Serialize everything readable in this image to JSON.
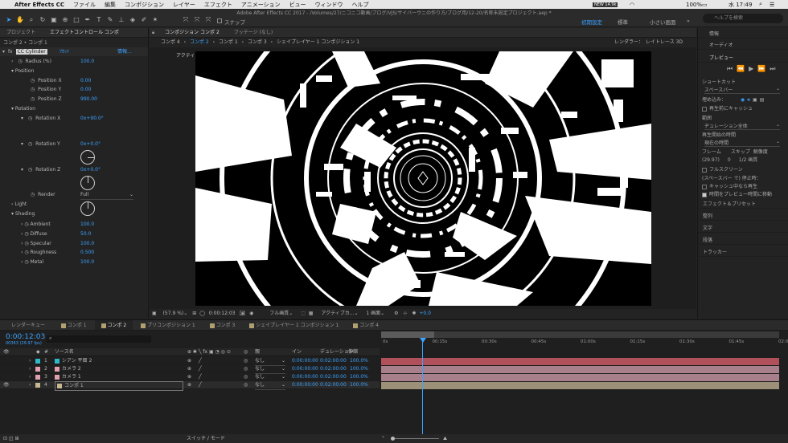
{
  "menubar": {
    "app_name": "After Effects CC",
    "items": [
      "ファイル",
      "編集",
      "コンポジション",
      "レイヤー",
      "エフェクト",
      "アニメーション",
      "ビュー",
      "ウィンドウ",
      "ヘルプ"
    ],
    "battery": "100%",
    "clock": "水 17:49",
    "net_label": "NEW 14.9k"
  },
  "toolbar": {
    "title": "Adobe After Effects CC 2017 - /Volumes/27/ニコニコ動画/ブログ/VJS/サイバーウニの作り方/ブログ用/12-20/名称未設定プロジェクト.aep *",
    "snap_label": "スナップ",
    "workspaces": [
      "初期設定",
      "標準",
      "小さい画面"
    ],
    "active_workspace": "初期設定",
    "help_placeholder": "ヘルプを検索"
  },
  "left_panel": {
    "tabs": [
      "プロジェクト",
      "エフェクトコントロール コンポ"
    ],
    "active_tab": "エフェクトコントロール コンポ",
    "header": "コンポ 2 • コンポ 1",
    "effect_name": "CC Cylinder",
    "reset_label": "ﾘｾｯﾄ",
    "info_label": "情報...",
    "radius": {
      "label": "Radius (%)",
      "value": "100.0"
    },
    "position_group": "Position",
    "position_x": {
      "label": "Position X",
      "value": "0.00"
    },
    "position_y": {
      "label": "Position Y",
      "value": "0.00"
    },
    "position_z": {
      "label": "Position Z",
      "value": "990.00"
    },
    "rotation_group": "Rotation",
    "rotation_x": {
      "label": "Rotation X",
      "value": "0x+90.0°"
    },
    "rotation_y": {
      "label": "Rotation Y",
      "value": "0x+0.0°"
    },
    "rotation_z": {
      "label": "Rotation Z",
      "value": "0x+0.0°"
    },
    "render": {
      "label": "Render",
      "value": "Full"
    },
    "light_group": "Light",
    "shading_group": "Shading",
    "ambient": {
      "label": "Ambient",
      "value": "100.0"
    },
    "diffuse": {
      "label": "Diffuse",
      "value": "50.0"
    },
    "specular": {
      "label": "Specular",
      "value": "100.0"
    },
    "roughness": {
      "label": "Roughness",
      "value": "0.500"
    },
    "metal": {
      "label": "Metal",
      "value": "100.0"
    }
  },
  "comp_panel": {
    "tabs": [
      "コンポジション コンポ 2",
      "フッテージ (なし)"
    ],
    "active_tab": "コンポジション コンポ 2",
    "breadcrumb": [
      "コンポ 4",
      "コンポ 2",
      "コンポ 1",
      "コンポ 3",
      "シェイプレイヤー 1 コンポジション 1"
    ],
    "active_crumb": "コンポ 2",
    "renderer_label": "レンダラー：",
    "renderer_value": "レイトレース 3D",
    "camera_label": "アクティブカメラ",
    "zoom": "(57.9 %)",
    "timecode": "0:00:12:03",
    "resolution": "フル画質",
    "view_camera": "アクティブカ...",
    "views": "1 画面",
    "exposure": "+0.0"
  },
  "right_panel": {
    "info": "情報",
    "audio": "オーディオ",
    "preview": "プレビュー",
    "shortcut_label": "ショートカット",
    "shortcut_value": "スペースバー",
    "embed_label": "埋め込み：",
    "cache_before": "再生前にキャッシュ",
    "range_label": "範囲",
    "range_value": "ヂュレーション全体",
    "play_from_label": "再生開始の時間",
    "play_from_value": "現在の時間",
    "frame_rate_label": "フレーム",
    "skip_label": "スキップ",
    "resolution_label": "解像度",
    "frame_rate_value": "(29.97)",
    "skip_value": "0",
    "resolution_value": "1/2 画質",
    "fullscreen": "フルスクリーン",
    "stop_label": "(スペースバー で) 停止時：",
    "stop_opt1": "キャッシュ中なら再生",
    "stop_opt2": "時間をプレビュー時間に移動",
    "sections": [
      "エフェクト＆プリセット",
      "整列",
      "文字",
      "段落",
      "トラッカー"
    ]
  },
  "timeline": {
    "tabs": [
      "レンダーキュー",
      "コンポ 1",
      "コンポ 2",
      "プリコンポジション 1",
      "コンポ 3",
      "シェイプレイヤー 1 コンポジション 1",
      "コンポ 4"
    ],
    "tab_colors": [
      "#aaaaaa",
      "#b0a070",
      "#b0a070",
      "#b0a070",
      "#b0a070",
      "#b0a070",
      "#b0a070"
    ],
    "active_tab": "コンポ 2",
    "current_time": "0:00:12:03",
    "frame_info": "00363 (29.97 fps)",
    "columns": {
      "num": "#",
      "source": "ソース名",
      "parent": "親",
      "in": "イン",
      "duration": "デュレーション",
      "stretch": "伸縮"
    },
    "ruler": [
      "0s",
      "00:15s",
      "00:30s",
      "00:45s",
      "01:00s",
      "01:15s",
      "01:30s",
      "01:45s",
      "02:0"
    ],
    "layers": [
      {
        "num": "1",
        "name": "シアン 平面 2",
        "color": "#2fb8c8",
        "parent": "なし",
        "in": "0:00:00:00",
        "duration": "0:02:00:00",
        "stretch": "100.0%",
        "bar_color": "#b0505a"
      },
      {
        "num": "2",
        "name": "カメラ 2",
        "color": "#e0a0b0",
        "parent": "なし",
        "in": "0:00:00:00",
        "duration": "0:02:00:00",
        "stretch": "100.0%",
        "bar_color": "#a8808c"
      },
      {
        "num": "3",
        "name": "カメラ 1",
        "color": "#e0a0b0",
        "parent": "なし",
        "in": "0:00:00:00",
        "duration": "0:02:00:00",
        "stretch": "100.0%",
        "bar_color": "#a8808c"
      },
      {
        "num": "4",
        "name": "コンポ 1",
        "color": "#c8b890",
        "parent": "なし",
        "in": "0:00:00:00",
        "duration": "0:02:00:00",
        "stretch": "100.0%",
        "bar_color": "#9c9078"
      }
    ],
    "switch_mode": "スイッチ / モード"
  }
}
